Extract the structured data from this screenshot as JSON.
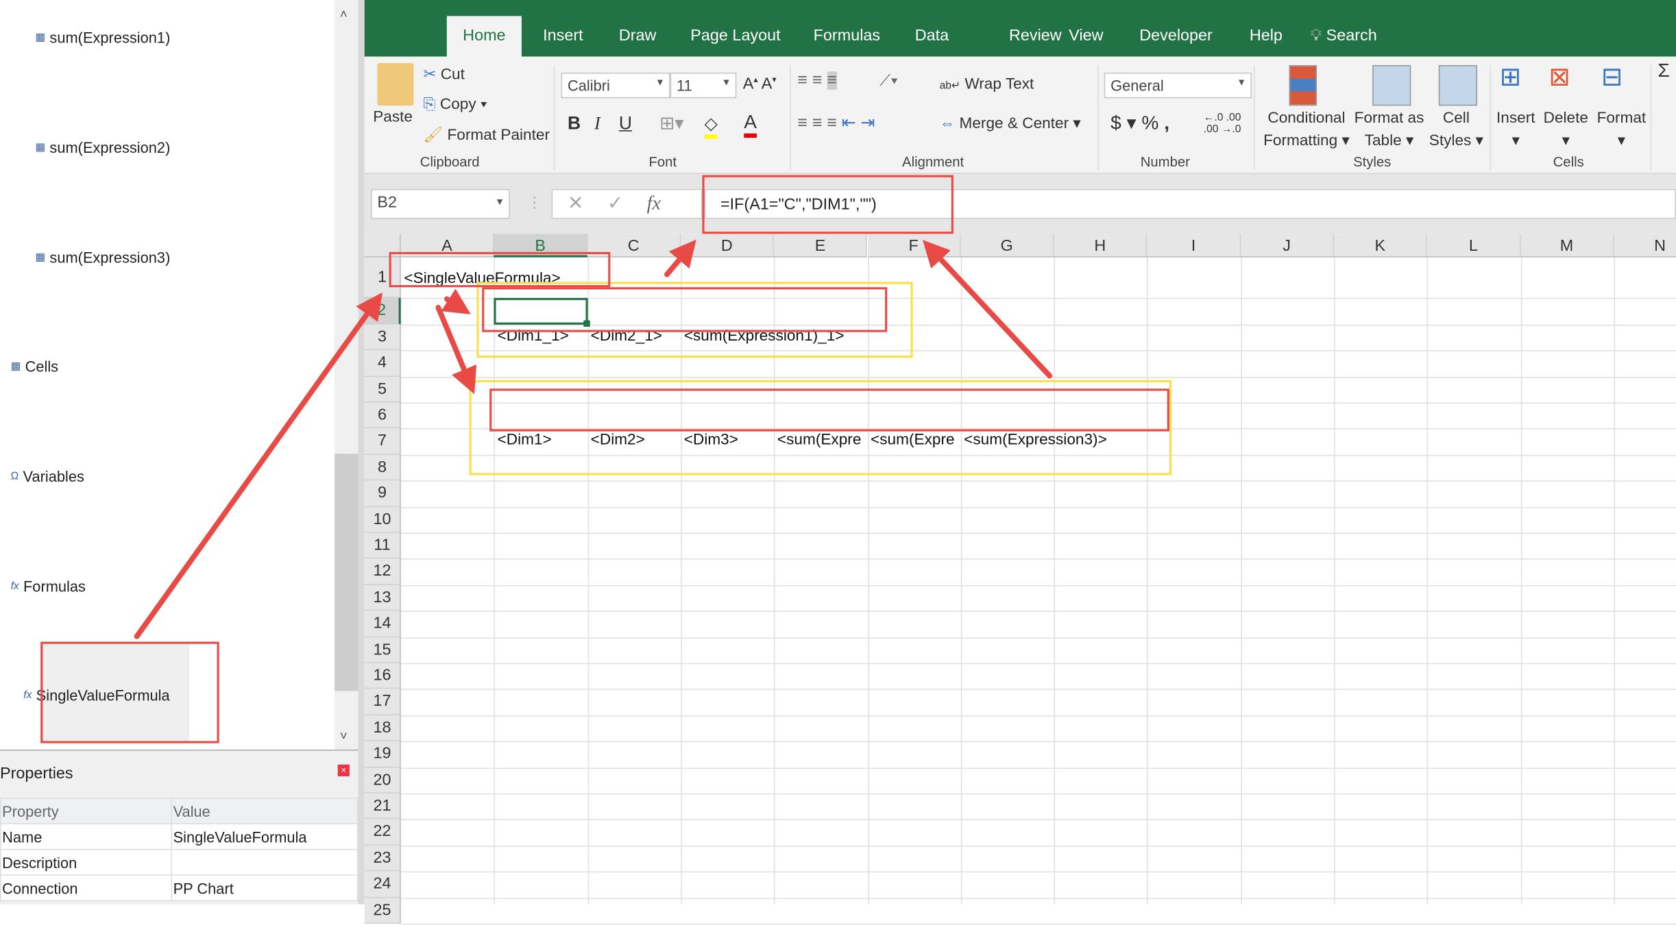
{
  "left_panel": {
    "tree": [
      {
        "label": "sum(Expression1)",
        "icon": "table-icon"
      },
      {
        "label": "sum(Expression2)",
        "icon": "table-icon"
      },
      {
        "label": "sum(Expression3)",
        "icon": "table-icon"
      },
      {
        "label": "Cells",
        "icon": "table-icon"
      },
      {
        "label": "Variables",
        "icon": "omega-icon"
      },
      {
        "label": "Formulas",
        "icon": "fx-icon"
      },
      {
        "label": "SingleValueFormula",
        "icon": "fx-icon"
      }
    ],
    "properties": {
      "title": "Properties",
      "headers": [
        "Property",
        "Value"
      ],
      "rows": [
        [
          "Name",
          "SingleValueFormula"
        ],
        [
          "Description",
          ""
        ],
        [
          "Connection",
          "PP Chart"
        ]
      ]
    }
  },
  "ribbon": {
    "tabs": [
      "Home",
      "Insert",
      "Draw",
      "Page Layout",
      "Formulas",
      "Data",
      "Review",
      "View",
      "Developer",
      "Help"
    ],
    "active_tab": "Home",
    "search": "Search",
    "clipboard": {
      "paste": "Paste",
      "cut": "Cut",
      "copy": "Copy",
      "format_painter": "Format Painter",
      "group": "Clipboard"
    },
    "font": {
      "name": "Calibri",
      "size": "11",
      "bold": "B",
      "italic": "I",
      "underline": "U",
      "group": "Font"
    },
    "alignment": {
      "wrap_text": "Wrap Text",
      "merge_center": "Merge & Center",
      "group": "Alignment"
    },
    "number": {
      "format": "General",
      "currency": "$",
      "percent": "%",
      "comma": ",",
      "group": "Number"
    },
    "styles": {
      "conditional": "Conditional",
      "conditional2": "Formatting",
      "format_as": "Format as",
      "format_as2": "Table",
      "cell": "Cell",
      "cell2": "Styles",
      "group": "Styles"
    },
    "cells": {
      "insert": "Insert",
      "delete": "Delete",
      "format": "Format",
      "group": "Cells"
    }
  },
  "formula_bar": {
    "name_box": "B2",
    "formula": "=IF(A1=\"C\",\"DIM1\",\"\")"
  },
  "sheet": {
    "columns": [
      "A",
      "B",
      "C",
      "D",
      "E",
      "F",
      "G",
      "H",
      "I",
      "J",
      "K",
      "L",
      "M",
      "N"
    ],
    "selected_column": "B",
    "selected_row": 2,
    "cells": {
      "A1": "<SingleValueFormula>",
      "B3": "<Dim1_1>",
      "C3": "<Dim2_1>",
      "D3": "<sum(Expression1)_1>",
      "B7": "<Dim1>",
      "C7": "<Dim2>",
      "D7": "<Dim3>",
      "E7": "<sum(Expre",
      "F7": "<sum(Expre",
      "G7": "<sum(Expression3)>"
    }
  },
  "colors": {
    "excel_green": "#217346",
    "annotation_red": "#e84a45",
    "annotation_yellow": "#f9df4a"
  }
}
